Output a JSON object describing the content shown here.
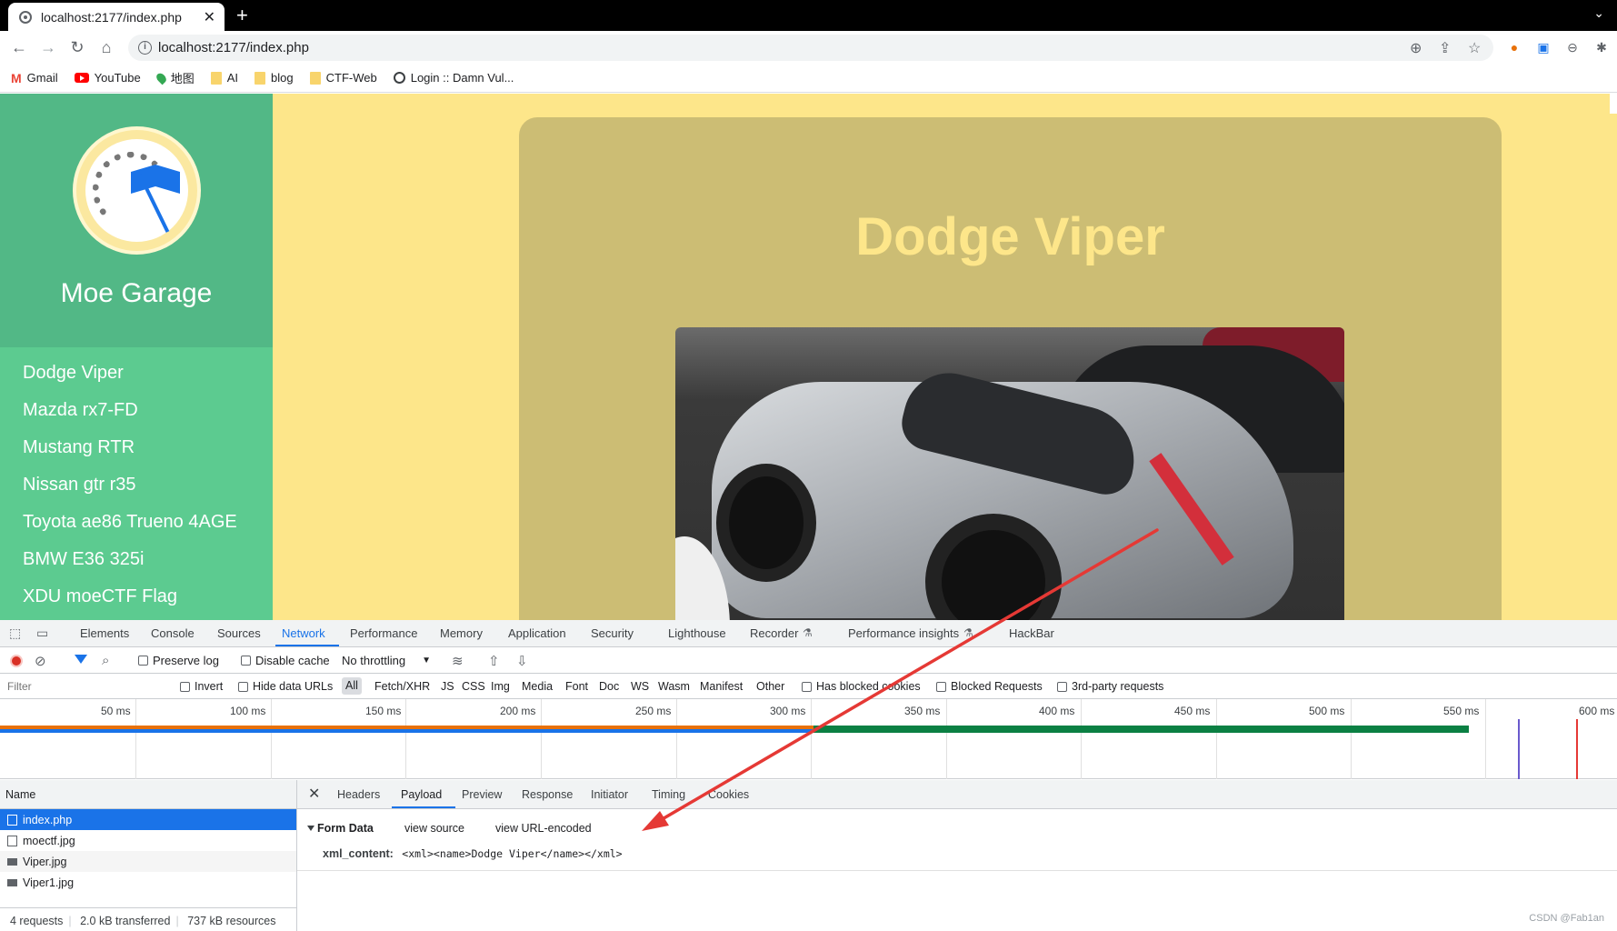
{
  "browser": {
    "tab_title": "localhost:2177/index.php",
    "url": "localhost:2177/index.php",
    "bookmarks": [
      {
        "label": "Gmail"
      },
      {
        "label": "YouTube"
      },
      {
        "label": "地图"
      },
      {
        "label": "AI"
      },
      {
        "label": "blog"
      },
      {
        "label": "CTF-Web"
      },
      {
        "label": "Login :: Damn Vul..."
      }
    ]
  },
  "site": {
    "brand": "Moe Garage",
    "nav": [
      "Dodge Viper",
      "Mazda rx7-FD",
      "Mustang RTR",
      "Nissan gtr r35",
      "Toyota ae86 Trueno 4AGE",
      "BMW E36 325i",
      "XDU moeCTF Flag"
    ],
    "card_title": "Dodge Viper"
  },
  "devtools": {
    "tabs": [
      "Elements",
      "Console",
      "Sources",
      "Network",
      "Performance",
      "Memory",
      "Application",
      "Security",
      "Lighthouse",
      "Recorder",
      "Performance insights",
      "HackBar"
    ],
    "active_tab": "Network",
    "toolbar": {
      "preserve_log": "Preserve log",
      "disable_cache": "Disable cache",
      "throttling": "No throttling"
    },
    "filter_placeholder": "Filter",
    "filter_options": {
      "invert": "Invert",
      "hide_data_urls": "Hide data URLs",
      "types": [
        "All",
        "Fetch/XHR",
        "JS",
        "CSS",
        "Img",
        "Media",
        "Font",
        "Doc",
        "WS",
        "Wasm",
        "Manifest",
        "Other"
      ],
      "has_blocked_cookies": "Has blocked cookies",
      "blocked_requests": "Blocked Requests",
      "third_party": "3rd-party requests"
    },
    "timeline_ticks": [
      "50 ms",
      "100 ms",
      "150 ms",
      "200 ms",
      "250 ms",
      "300 ms",
      "350 ms",
      "400 ms",
      "450 ms",
      "500 ms",
      "550 ms",
      "600 ms"
    ],
    "requests": {
      "header": "Name",
      "items": [
        "index.php",
        "moectf.jpg",
        "Viper.jpg",
        "Viper1.jpg"
      ],
      "footer": [
        "4 requests",
        "2.0 kB transferred",
        "737 kB resources"
      ]
    },
    "detail": {
      "tabs": [
        "Headers",
        "Payload",
        "Preview",
        "Response",
        "Initiator",
        "Timing",
        "Cookies"
      ],
      "active_tab": "Payload",
      "form_data_label": "Form Data",
      "view_source": "view source",
      "view_url_encoded": "view URL-encoded",
      "field_key": "xml_content:",
      "field_value": "<xml><name>Dodge Viper</name></xml>"
    }
  },
  "watermark": "CSDN @Fab1an",
  "colors": {
    "sidebar": "#5ccb90",
    "page_bg": "#fde68a",
    "card": "#ccbd74",
    "accent": "#1a73e8",
    "annotation_arrow": "#e53935"
  }
}
